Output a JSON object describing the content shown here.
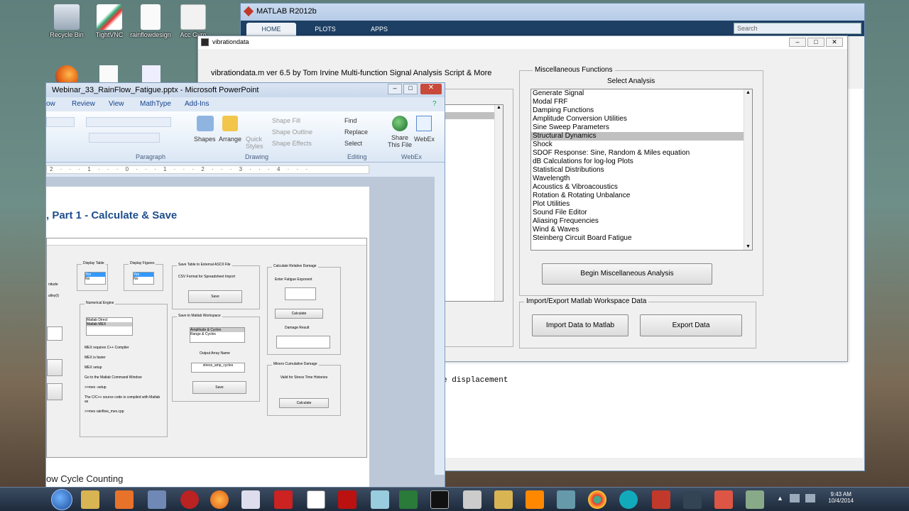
{
  "desktop": {
    "icons": [
      {
        "label": "Recycle Bin"
      },
      {
        "label": "TightVNC"
      },
      {
        "label": "rainflowdesign"
      },
      {
        "label": "Acc Gyro"
      }
    ]
  },
  "matlab": {
    "title": "MATLAB R2012b",
    "tabs": [
      "HOME",
      "PLOTS",
      "APPS"
    ],
    "search_placeholder": "Search",
    "command_text": "e displacement"
  },
  "vibrationdata": {
    "title": "vibrationdata",
    "header": "vibrationdata.m     ver 6.5    by Tom Irvine      Multi-function Signal Analysis Script & More",
    "misc_group_label": "Miscellaneous Functions",
    "select_label": "Select Analysis",
    "analysis_list": [
      "Generate Signal",
      "Modal FRF",
      "Damping Functions",
      "Amplitude Conversion Utilities",
      "Sine Sweep Parameters",
      "Structural Dynamics",
      "Shock",
      "SDOF Response: Sine, Random & Miles equation",
      "dB Calculations for log-log Plots",
      "Statistical Distributions",
      "Wavelength",
      "Acoustics & Vibroacoustics",
      "Rotation & Rotating Unbalance",
      "Plot Utilities",
      "Sound File Editor",
      "Aliasing Frequencies",
      "Wind & Waves",
      "Steinberg Circuit Board Fatigue"
    ],
    "selected_index": 5,
    "begin_button": "Begin Miscellaneous Analysis",
    "import_export_label": "Import/Export Matlab Workspace Data",
    "import_button": "Import Data to Matlab",
    "export_button": "Export Data"
  },
  "powerpoint": {
    "title": "Webinar_33_RainFlow_Fatigue.pptx - Microsoft PowerPoint",
    "tabs": [
      "ow",
      "Review",
      "View",
      "MathType",
      "Add-Ins"
    ],
    "ribbon": {
      "paragraph_label": "Paragraph",
      "drawing_label": "Drawing",
      "editing_label": "Editing",
      "webex_label": "WebEx",
      "shapes": "Shapes",
      "arrange": "Arrange",
      "quick_styles": "Quick Styles",
      "shape_fill": "Shape Fill",
      "shape_outline": "Shape Outline",
      "shape_effects": "Shape Effects",
      "find": "Find",
      "replace": "Replace",
      "select": "Select",
      "share_this_file": "Share This File",
      "webex": "WebEx"
    },
    "ruler": "2 · · · 1 · · · 0 · · · 1 · · · 2 · · · 3 · · · 4 · · ·",
    "slide_title": ", Part 1  -  Calculate & Save",
    "slide_footer": "ow Cycle Counting"
  },
  "inner_gui": {
    "display_table": "Display Table",
    "display_figures": "Display Figures",
    "yes": "Yes",
    "no": "No",
    "save_table_label": "Save Table to External ASCII File",
    "csv_format": "CSV Format for Spreadsheet Import",
    "save": "Save",
    "calc_damage_label": "Calculate Relative Damage",
    "enter_exponent": "Enter Fatigue Exponent",
    "calculate": "Calculate",
    "damage_result": "Damage Result",
    "numerical_engine_label": "Numerical Engine",
    "matlab_direct": "Matlab Direct",
    "matlab_mex": "Matlab MEX",
    "save_workspace_label": "Save to Matlab Workspace",
    "amp_cycles": "Amplitude & Cycles",
    "range_cycles": "Range & Cycles",
    "output_array_name": "Output Array Name",
    "output_array_value": "stress_amp_cycles",
    "miners_label": "Miners Cumulative Damage",
    "valid_for": "Valid for Stress Time Histories",
    "mex_notes": [
      "MEX requires C++ Compiler",
      "MEX is faster",
      "MEX setup",
      "Go to the Matlab Command Window",
      ">>mex -setup",
      "The C/C++ source code is compiled with Matlab as",
      ">>mex rainflow_mex.cpp"
    ],
    "side_text_1": "nitude",
    "side_text_2": "alley(t)"
  },
  "taskbar": {
    "time": "9:43 AM",
    "date": "10/4/2014"
  }
}
